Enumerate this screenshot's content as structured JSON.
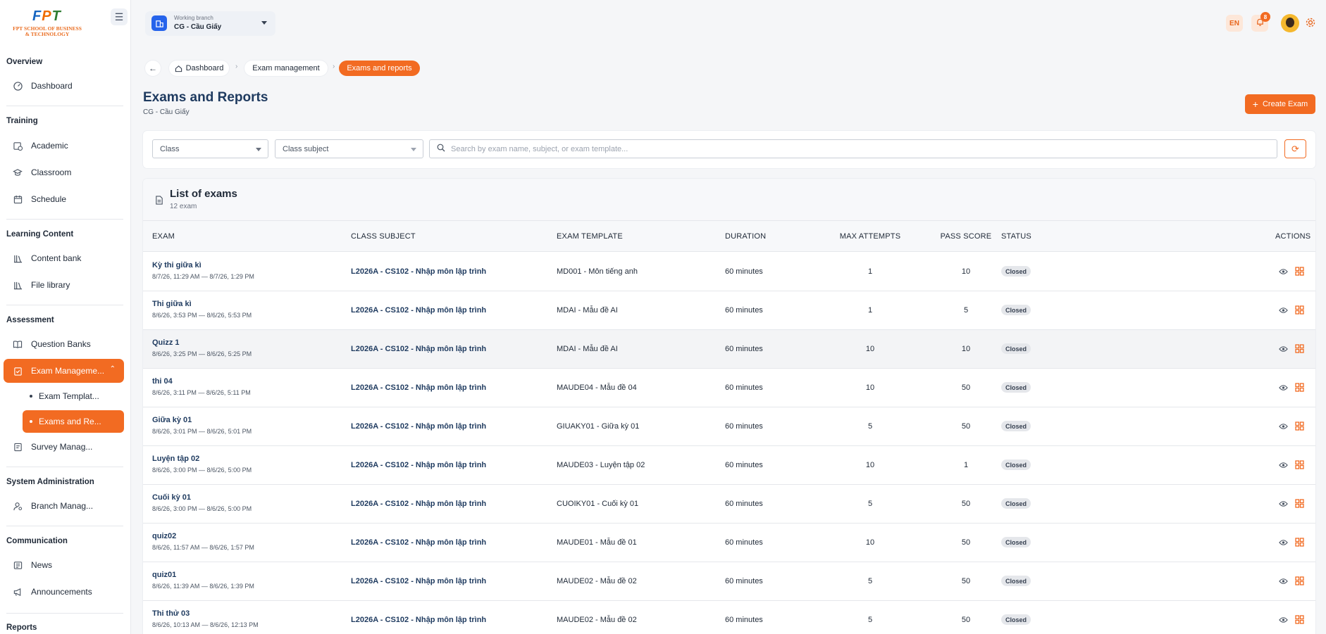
{
  "brand": {
    "logo_mark": "FPT",
    "logo_text_line1": "FPT SCHOOL OF BUSINESS",
    "logo_text_line2": "& TECHNOLOGY"
  },
  "sidebar": {
    "sections": [
      {
        "title": "Overview"
      },
      {
        "title": "Training"
      },
      {
        "title": "Learning Content"
      },
      {
        "title": "Assessment"
      },
      {
        "title": "System Administration"
      },
      {
        "title": "Communication"
      },
      {
        "title": "Reports"
      }
    ],
    "items": {
      "dashboard": "Dashboard",
      "academic": "Academic",
      "classroom": "Classroom",
      "schedule": "Schedule",
      "content_bank": "Content bank",
      "file_library": "File library",
      "question_banks": "Question Banks",
      "exam_management": "Exam Manageme...",
      "exam_templates": "Exam Templat...",
      "exams_reports": "Exams and Re...",
      "survey": "Survey Manag...",
      "branch": "Branch Manag...",
      "news": "News",
      "announcements": "Announcements"
    }
  },
  "header": {
    "branch_label": "Working branch",
    "branch_value": "CG - Cầu Giấy",
    "lang": "EN",
    "notif_count": "8"
  },
  "breadcrumb": {
    "dashboard": "Dashboard",
    "exam_management": "Exam management",
    "current": "Exams and reports"
  },
  "page": {
    "title": "Exams and Reports",
    "subtitle": "CG - Cầu Giấy",
    "create_label": "Create Exam"
  },
  "filters": {
    "class_value": "Class",
    "class_subject_value": "Class subject",
    "search_placeholder": "Search by exam name, subject, or exam template..."
  },
  "list": {
    "title": "List of exams",
    "count": "12 exam",
    "columns": [
      "EXAM",
      "CLASS SUBJECT",
      "EXAM TEMPLATE",
      "DURATION",
      "MAX ATTEMPTS",
      "PASS SCORE",
      "STATUS",
      "ACTIONS"
    ],
    "rows": [
      {
        "name": "Kỳ thi giữa kì",
        "dates": "8/7/26, 11:29 AM — 8/7/26, 1:29 PM",
        "subject": "L2026A - CS102 - Nhập môn lập trình",
        "template": "MD001 - Môn tiếng anh",
        "duration": "60 minutes",
        "max": "1",
        "pass": "10",
        "status": "Closed"
      },
      {
        "name": "Thi giữa kì",
        "dates": "8/6/26, 3:53 PM — 8/6/26, 5:53 PM",
        "subject": "L2026A - CS102 - Nhập môn lập trình",
        "template": "MDAI - Mẫu đề AI",
        "duration": "60 minutes",
        "max": "1",
        "pass": "5",
        "status": "Closed"
      },
      {
        "name": "Quizz 1",
        "dates": "8/6/26, 3:25 PM — 8/6/26, 5:25 PM",
        "subject": "L2026A - CS102 - Nhập môn lập trình",
        "template": "MDAI - Mẫu đề AI",
        "duration": "60 minutes",
        "max": "10",
        "pass": "10",
        "status": "Closed"
      },
      {
        "name": "thi 04",
        "dates": "8/6/26, 3:11 PM — 8/6/26, 5:11 PM",
        "subject": "L2026A - CS102 - Nhập môn lập trình",
        "template": "MAUDE04 - Mẫu đề 04",
        "duration": "60 minutes",
        "max": "10",
        "pass": "50",
        "status": "Closed"
      },
      {
        "name": "Giữa kỳ 01",
        "dates": "8/6/26, 3:01 PM — 8/6/26, 5:01 PM",
        "subject": "L2026A - CS102 - Nhập môn lập trình",
        "template": "GIUAKY01 - Giữa kỳ 01",
        "duration": "60 minutes",
        "max": "5",
        "pass": "50",
        "status": "Closed"
      },
      {
        "name": "Luyện tập 02",
        "dates": "8/6/26, 3:00 PM — 8/6/26, 5:00 PM",
        "subject": "L2026A - CS102 - Nhập môn lập trình",
        "template": "MAUDE03 - Luyện tập 02",
        "duration": "60 minutes",
        "max": "10",
        "pass": "1",
        "status": "Closed"
      },
      {
        "name": "Cuối kỳ 01",
        "dates": "8/6/26, 3:00 PM — 8/6/26, 5:00 PM",
        "subject": "L2026A - CS102 - Nhập môn lập trình",
        "template": "CUOIKY01 - Cuối kỳ 01",
        "duration": "60 minutes",
        "max": "5",
        "pass": "50",
        "status": "Closed"
      },
      {
        "name": "quiz02",
        "dates": "8/6/26, 11:57 AM — 8/6/26, 1:57 PM",
        "subject": "L2026A - CS102 - Nhập môn lập trình",
        "template": "MAUDE01 - Mẫu đề 01",
        "duration": "60 minutes",
        "max": "10",
        "pass": "50",
        "status": "Closed"
      },
      {
        "name": "quiz01",
        "dates": "8/6/26, 11:39 AM — 8/6/26, 1:39 PM",
        "subject": "L2026A - CS102 - Nhập môn lập trình",
        "template": "MAUDE02 - Mẫu đề 02",
        "duration": "60 minutes",
        "max": "5",
        "pass": "50",
        "status": "Closed"
      },
      {
        "name": "Thi thử 03",
        "dates": "8/6/26, 10:13 AM — 8/6/26, 12:13 PM",
        "subject": "L2026A - CS102 - Nhập môn lập trình",
        "template": "MAUDE02 - Mẫu đề 02",
        "duration": "60 minutes",
        "max": "5",
        "pass": "50",
        "status": "Closed"
      }
    ]
  },
  "colors": {
    "accent": "#f26b22",
    "title_navy": "#1e3a5f"
  }
}
